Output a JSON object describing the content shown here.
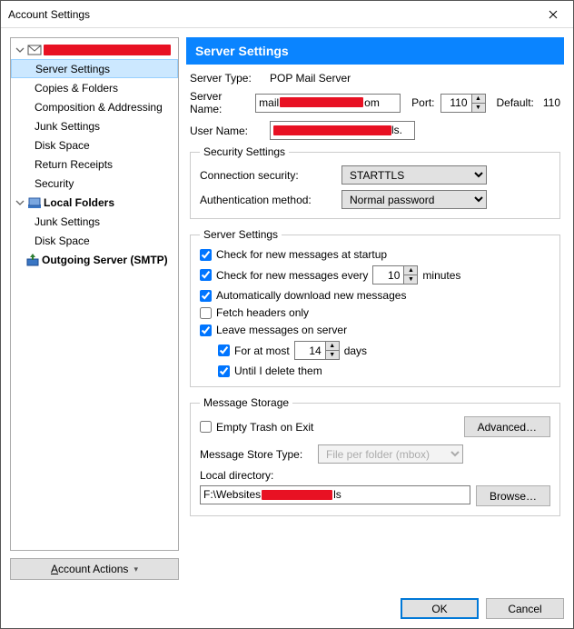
{
  "window": {
    "title": "Account Settings"
  },
  "sidebar": {
    "account_redacted_label": "",
    "items": {
      "server_settings": "Server Settings",
      "copies_folders": "Copies & Folders",
      "composition": "Composition & Addressing",
      "junk": "Junk Settings",
      "disk": "Disk Space",
      "receipts": "Return Receipts",
      "security": "Security"
    },
    "local_folders": "Local Folders",
    "lf_junk": "Junk Settings",
    "lf_disk": "Disk Space",
    "outgoing": "Outgoing Server (SMTP)",
    "account_actions": "Account Actions"
  },
  "main": {
    "heading": "Server Settings",
    "server_type_label": "Server Type:",
    "server_type_value": "POP Mail Server",
    "server_name_label": "Server Name:",
    "server_name_value_prefix": "mail",
    "server_name_value_suffix": "om",
    "port_label": "Port:",
    "port_value": "110",
    "default_label": "Default:",
    "default_value": "110",
    "user_name_label": "User Name:",
    "user_name_suffix": "ls."
  },
  "security": {
    "legend": "Security Settings",
    "conn_label": "Connection security:",
    "conn_value": "STARTTLS",
    "auth_label": "Authentication method:",
    "auth_value": "Normal password"
  },
  "server": {
    "legend": "Server Settings",
    "check_startup": "Check for new messages at startup",
    "check_every_pre": "Check for new messages every",
    "check_every_value": "10",
    "check_every_post": "minutes",
    "auto_download": "Automatically download new messages",
    "fetch_headers": "Fetch headers only",
    "leave_server": "Leave messages on server",
    "for_at_most_pre": "For at most",
    "for_at_most_value": "14",
    "for_at_most_post": "days",
    "until_delete": "Until I delete them"
  },
  "storage": {
    "legend": "Message Storage",
    "empty_trash": "Empty Trash on Exit",
    "advanced": "Advanced…",
    "store_type_label": "Message Store Type:",
    "store_type_value": "File per folder (mbox)",
    "local_dir_label": "Local directory:",
    "local_dir_prefix": "F:\\Websites",
    "local_dir_suffix": "ls",
    "browse": "Browse…"
  },
  "footer": {
    "ok": "OK",
    "cancel": "Cancel"
  }
}
